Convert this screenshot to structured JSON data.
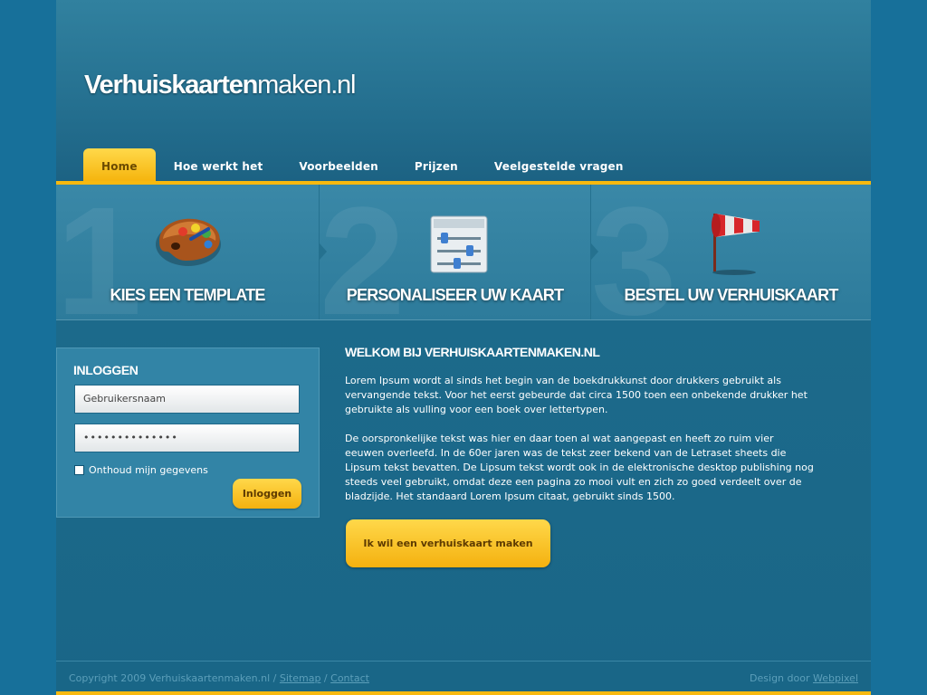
{
  "logo": {
    "bold": "Verhuiskaarten",
    "light": "maken.nl"
  },
  "nav": [
    {
      "label": "Home",
      "active": true
    },
    {
      "label": "Hoe werkt het"
    },
    {
      "label": "Voorbeelden"
    },
    {
      "label": "Prijzen"
    },
    {
      "label": "Veelgestelde vragen"
    }
  ],
  "steps": [
    {
      "number": "1",
      "title": "KIES EEN TEMPLATE",
      "icon": "palette-icon"
    },
    {
      "number": "2",
      "title": "PERSONALISEER UW KAART",
      "icon": "sliders-icon"
    },
    {
      "number": "3",
      "title": "BESTEL UW VERHUISKAART",
      "icon": "windsock-icon"
    }
  ],
  "login": {
    "title": "INLOGGEN",
    "username_placeholder": "Gebruikersnaam",
    "password_value": "••••••••••••••",
    "remember_label": "Onthoud mijn gegevens",
    "button_label": "Inloggen"
  },
  "main": {
    "title": "WELKOM BIJ VERHUISKAARTENMAKEN.NL",
    "paragraphs": [
      "Lorem Ipsum wordt al sinds het begin van de boekdrukkunst door drukkers gebruikt als vervangende tekst. Voor het eerst gebeurde dat circa 1500 toen een onbekende drukker het gebruikte als vulling voor een boek over lettertypen.",
      "De oorspronkelijke tekst was hier en daar toen al wat aangepast en heeft zo ruim vier eeuwen overleefd. In de 60er jaren was de tekst zeer bekend van de Letraset sheets die Lipsum tekst bevatten. De Lipsum tekst wordt ook in de elektronische desktop publishing nog steeds veel gebruikt, omdat deze een pagina zo mooi vult en zich zo goed verdeelt over de bladzijde. Het standaard Lorem Ipsum citaat, gebruikt sinds 1500."
    ],
    "cta_label": "Ik wil een verhuiskaart maken"
  },
  "footer": {
    "copyright": "Copyright 2009 Verhuiskaartenmaken.nl / ",
    "sitemap": "Sitemap",
    "separator": " / ",
    "contact": "Contact",
    "design_by": "Design door ",
    "designer": "Webpixel"
  },
  "colors": {
    "background": "#17709a",
    "accent": "#f7b90f",
    "text": "#ffffff"
  }
}
